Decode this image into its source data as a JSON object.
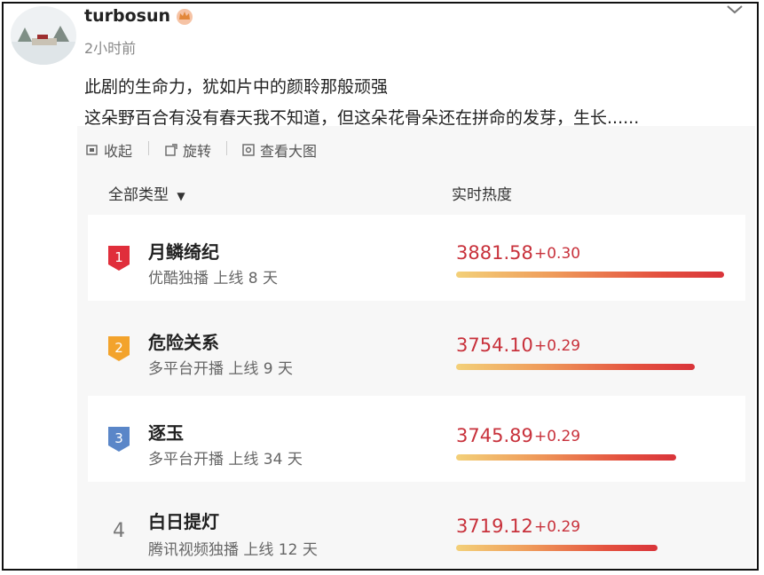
{
  "post": {
    "username": "turbosun",
    "time": "2小时前",
    "lines": [
      "此剧的生命力，犹如片中的颜聆那般顽强",
      "这朵野百合有没有春天我不知道，但这朵花骨朵还在拼命的发芽，生长......"
    ]
  },
  "toolbar": {
    "collapse_label": "收起",
    "rotate_label": "旋转",
    "view_large_label": "查看大图"
  },
  "ranking": {
    "filter_label": "全部类型",
    "heat_label": "实时热度",
    "accent_colors": {
      "rank1": "#e02e3b",
      "rank2": "#f3a32c",
      "rank3": "#5a86c8",
      "score": "#c8313b"
    },
    "items": [
      {
        "rank": "1",
        "title": "月鳞绮纪",
        "info": "优酷独播 上线 8 天",
        "score": "3881.58",
        "delta": "+0.30",
        "fill": 1.0
      },
      {
        "rank": "2",
        "title": "危险关系",
        "info": "多平台开播 上线 9 天",
        "score": "3754.10",
        "delta": "+0.29",
        "fill": 0.89
      },
      {
        "rank": "3",
        "title": "逐玉",
        "info": "多平台开播 上线 34 天",
        "score": "3745.89",
        "delta": "+0.29",
        "fill": 0.82
      },
      {
        "rank": "4",
        "title": "白日提灯",
        "info": "腾讯视频独播 上线 12 天",
        "score": "3719.12",
        "delta": "+0.29",
        "fill": 0.75
      }
    ]
  }
}
